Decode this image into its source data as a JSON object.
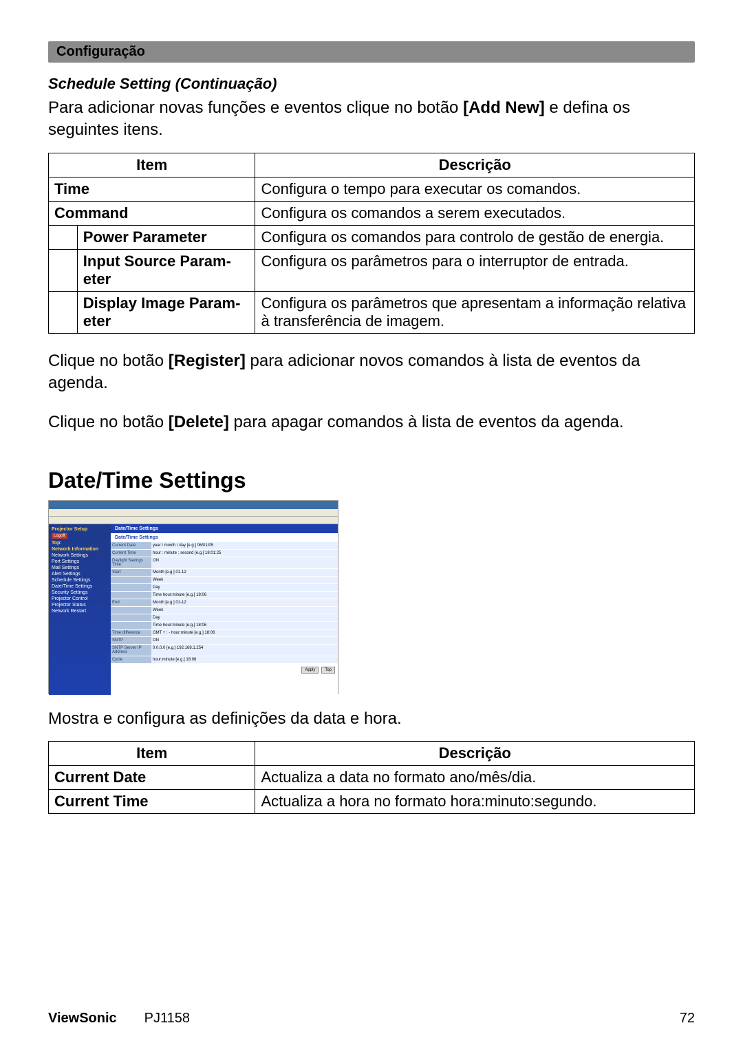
{
  "header": {
    "title": "Configuração"
  },
  "schedule": {
    "subheading": "Schedule Setting (Continuação)",
    "intro_pre": "Para adicionar novas funções e eventos clique no botão ",
    "intro_bold": "[Add New]",
    "intro_post": " e defina os seguintes itens.",
    "th_item": "Item",
    "th_desc": "Descrição",
    "rows": {
      "time_item": "Time",
      "time_desc": "Configura o tempo para executar os comandos.",
      "command_item": "Command",
      "command_desc": "Configura os comandos a serem executados.",
      "power_item": "Power Parameter",
      "power_desc": "Configura os comandos para controlo de gestão de energia.",
      "input_item": "Input Source Param­eter",
      "input_desc": "Configura os parâmetros para o interruptor de entrada.",
      "display_item": "Display Image Param­eter",
      "display_desc": "Configura os parâmetros que apresentam a informação rela­tiva à transferência de imagem."
    },
    "para2_pre": "Clique no botão ",
    "para2_bold": "[Register]",
    "para2_post": " para adicionar novos comandos à lista de eventos da agenda.",
    "para3_pre": "Clique no botão ",
    "para3_bold": "[Delete]",
    "para3_post": " para apagar comandos à lista de eventos da agenda."
  },
  "datetime": {
    "heading": "Date/Time Settings",
    "intro": "Mostra e configura as definições da data e hora.",
    "th_item": "Item",
    "th_desc": "Descrição",
    "rows": {
      "cd_item": "Current Date",
      "cd_desc": "Actualiza a data no formato ano/mês/dia.",
      "ct_item": "Current Time",
      "ct_desc": "Actualiza a hora no formato hora:minuto:segundo."
    }
  },
  "screenshot": {
    "nav_title": "Projector Setup",
    "main_title": "Date/Time Settings",
    "sub_title": "Date/Time Settings",
    "logoff": "Logoff",
    "nav_top": "Top:",
    "nav_net": "Network Information",
    "nav_items": [
      "Network Settings",
      "Port Settings",
      "Mail Settings",
      "Alert Settings",
      "Schedule Settings",
      "Date/Time Settings",
      "Security Settings",
      "Projector Control",
      "Projector Status",
      "Network Restart"
    ],
    "labels": {
      "cd": "Current Date",
      "ct": "Current Time",
      "dst": "Daylight Savings Time",
      "start": "Start",
      "end": "End",
      "td": "Time difference",
      "sntp": "SNTP",
      "ip": "SNTP Server IP Address",
      "cycle": "Cycle"
    },
    "vals": {
      "cd": "year / month / day   [e.g.] 06/01/05",
      "ct": "hour : minute : second   [e.g.] 18:01:25",
      "start_m": "Month   [e.g.] 01-12",
      "start_w": "Week",
      "start_d": "Day",
      "start_t": "Time hour:minute   [e.g.] 18:06",
      "end_m": "Month   [e.g.] 01-12",
      "end_w": "Week",
      "end_d": "Day",
      "end_t": "Time hour:minute   [e.g.] 18:06",
      "td": "GMT  + :  -   hour:minute   [e.g.] 18:06",
      "ip": "0.0.0.0   [e.g.] 192.168.1.254",
      "cycle": "hour:minute   [e.g.] 18:06",
      "on": "ON"
    },
    "btn_apply": "Apply",
    "btn_top": "Top"
  },
  "footer": {
    "brand": "ViewSonic",
    "model": "PJ1158",
    "page": "72"
  }
}
